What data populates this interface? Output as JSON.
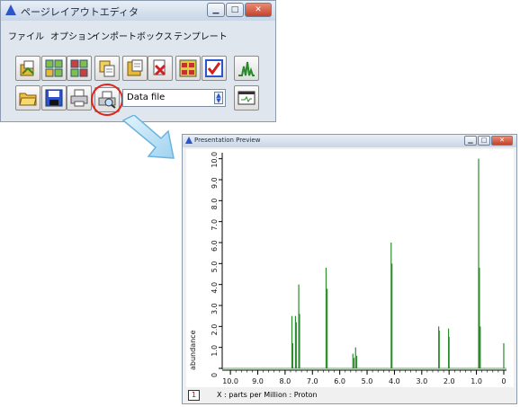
{
  "editor": {
    "title": "ページレイアウトエディタ",
    "menu": [
      "ファイル",
      "オプション",
      "インポート",
      "ボックス",
      "テンプレート"
    ],
    "combo_value": "Data file",
    "toolbar_row1_icons": [
      "import-data-icon",
      "grid-layout-icon",
      "grid-layout-2-icon",
      "copy-boxes-icon",
      "paste-box-icon",
      "delete-box-icon",
      "align-boxes-icon",
      "check-box-icon",
      "spectrum-view-icon"
    ],
    "toolbar_row2_icons": [
      "open-folder-icon",
      "save-disk-icon",
      "printer-icon",
      "print-preview-icon",
      "window-preview-icon"
    ]
  },
  "preview": {
    "title": "Presentation Preview",
    "page_number": "1",
    "status_label": "X : parts per Million : Proton"
  },
  "chart_data": {
    "type": "line",
    "ylabel": "abundance",
    "xlabel": "X : parts per Million : Proton",
    "x_ticks": [
      "10.0",
      "9.0",
      "8.0",
      "7.0",
      "6.0",
      "5.0",
      "4.0",
      "3.0",
      "2.0",
      "1.0",
      "0"
    ],
    "y_ticks": [
      "0",
      "1.0",
      "2.0",
      "3.0",
      "4.0",
      "5.0",
      "6.0",
      "7.0",
      "8.0",
      "9.0",
      "10.0"
    ],
    "xlim": [
      10.3,
      -0.1
    ],
    "ylim": [
      0,
      10.2
    ],
    "peaks": [
      {
        "x": 7.75,
        "y": 2.5
      },
      {
        "x": 7.72,
        "y": 1.2
      },
      {
        "x": 7.62,
        "y": 2.5
      },
      {
        "x": 7.59,
        "y": 2.2
      },
      {
        "x": 7.5,
        "y": 4.0
      },
      {
        "x": 7.47,
        "y": 2.6
      },
      {
        "x": 6.5,
        "y": 4.8
      },
      {
        "x": 6.46,
        "y": 3.8
      },
      {
        "x": 5.52,
        "y": 0.7
      },
      {
        "x": 5.48,
        "y": 0.5
      },
      {
        "x": 5.42,
        "y": 1.0
      },
      {
        "x": 5.38,
        "y": 0.6
      },
      {
        "x": 4.12,
        "y": 6.0
      },
      {
        "x": 4.09,
        "y": 5.0
      },
      {
        "x": 2.38,
        "y": 2.0
      },
      {
        "x": 2.36,
        "y": 1.8
      },
      {
        "x": 2.02,
        "y": 1.9
      },
      {
        "x": 2.0,
        "y": 1.5
      },
      {
        "x": 0.92,
        "y": 10.0
      },
      {
        "x": 0.89,
        "y": 4.8
      },
      {
        "x": 0.86,
        "y": 2.0
      },
      {
        "x": 0.0,
        "y": 1.2
      }
    ],
    "line_color": "#2e8b2e"
  }
}
